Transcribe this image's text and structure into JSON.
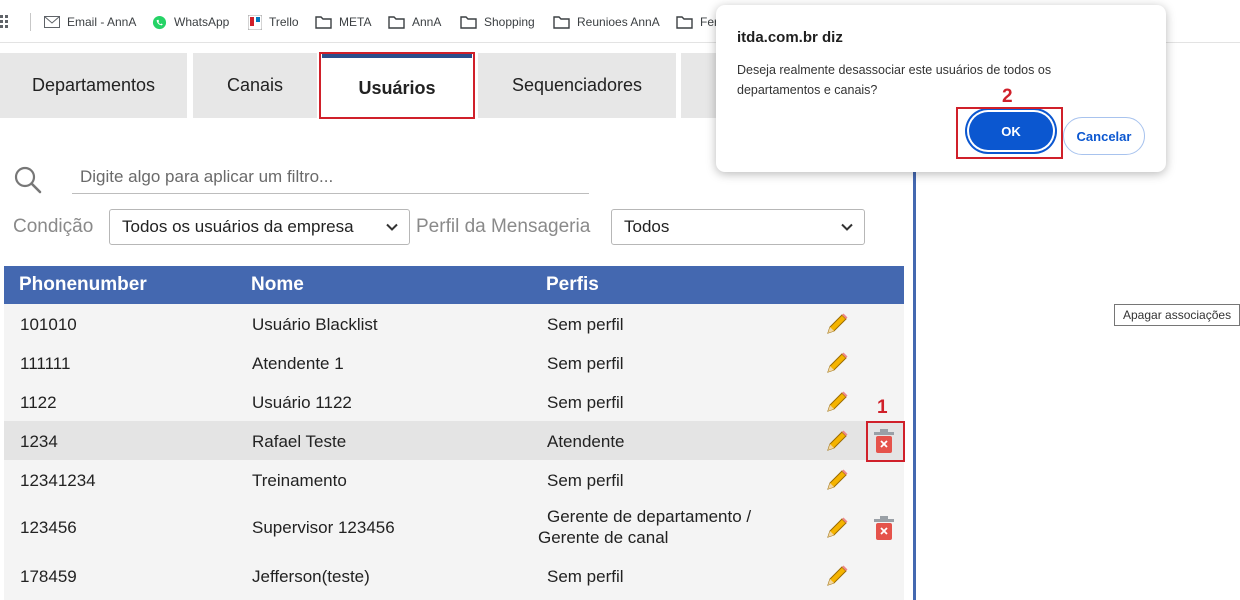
{
  "bookmarks": [
    {
      "label": "Email - AnnA",
      "icon": "envelope-icon"
    },
    {
      "label": "WhatsApp",
      "icon": "whatsapp-icon"
    },
    {
      "label": "Trello",
      "icon": "trello-icon"
    },
    {
      "label": "META",
      "icon": "folder-icon"
    },
    {
      "label": "AnnA",
      "icon": "folder-icon"
    },
    {
      "label": "Shopping",
      "icon": "folder-icon"
    },
    {
      "label": "Reunioes AnnA",
      "icon": "folder-icon"
    },
    {
      "label": "Fer",
      "icon": "folder-icon"
    }
  ],
  "tabs": [
    "Departamentos",
    "Canais",
    "Usuários",
    "Sequenciadores"
  ],
  "active_tab": "Usuários",
  "filter": {
    "placeholder": "Digite algo para aplicar um filtro...",
    "condition_label": "Condição",
    "condition_value": "Todos os usuários da empresa",
    "profile_label": "Perfil da Mensageria",
    "profile_value": "Todos"
  },
  "table": {
    "headers": [
      "Phonenumber",
      "Nome",
      "Perfis"
    ],
    "rows": [
      {
        "phone": "101010",
        "name": "Usuário Blacklist",
        "profile": "Sem perfil"
      },
      {
        "phone": "111111",
        "name": "Atendente 1",
        "profile": "Sem perfil"
      },
      {
        "phone": "1122",
        "name": "Usuário 1122",
        "profile": "Sem perfil"
      },
      {
        "phone": "1234",
        "name": "Rafael Teste",
        "profile": "Atendente"
      },
      {
        "phone": "12341234",
        "name": "Treinamento",
        "profile": "Sem perfil"
      },
      {
        "phone": "123456",
        "name": "Supervisor 123456",
        "profile_line1": "Gerente de departamento /",
        "profile_line2": "Gerente de canal"
      },
      {
        "phone": "178459",
        "name": "Jefferson(teste)",
        "profile": "Sem perfil"
      }
    ]
  },
  "tooltip": "Apagar associações",
  "dialog": {
    "title": "itda.com.br diz",
    "message": "Deseja realmente desassociar este usuários de todos os departamentos e canais?",
    "ok_label": "OK",
    "cancel_label": "Cancelar"
  },
  "annotations": {
    "step1": "1",
    "step2": "2"
  },
  "colors": {
    "header_blue": "#4468b0",
    "highlight_red": "#d0202a",
    "ok_blue": "#0b57d0",
    "trash_red": "#e5534b"
  }
}
